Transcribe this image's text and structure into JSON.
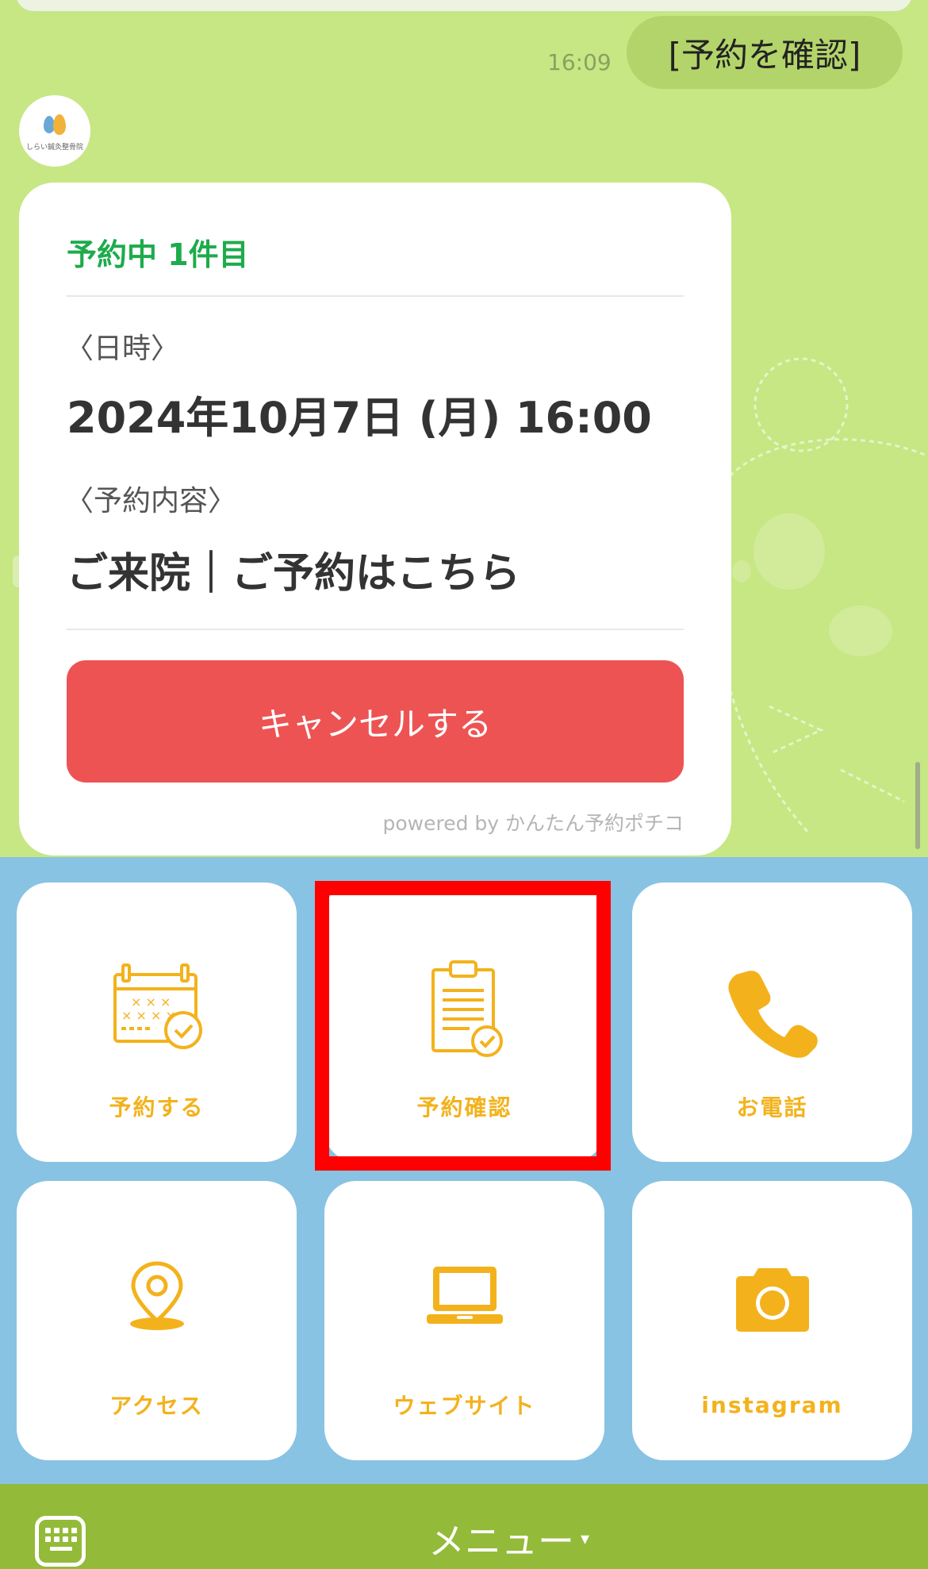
{
  "chat": {
    "sent_message": "[予約を確認]",
    "sent_time": "16:09",
    "avatar_name": "しらい鍼灸整骨院"
  },
  "card": {
    "title": "予約中 1件目",
    "datetime_label": "〈日時〉",
    "datetime_value": "2024年10月7日 (月) 16:00",
    "content_label": "〈予約内容〉",
    "content_value": "ご来院｜ご予約はこちら",
    "cancel_label": "キャンセルする",
    "powered_by": "powered by かんたん予約ポチコ",
    "title_color": "#1eab4c",
    "cancel_color": "#ee5353"
  },
  "menu": {
    "tiles": [
      {
        "label": "予約する",
        "icon": "calendar-check-icon"
      },
      {
        "label": "予約確認",
        "icon": "clipboard-check-icon"
      },
      {
        "label": "お電話",
        "icon": "phone-icon"
      },
      {
        "label": "アクセス",
        "icon": "map-pin-icon"
      },
      {
        "label": "ウェブサイト",
        "icon": "laptop-icon"
      },
      {
        "label": "instagram",
        "icon": "camera-icon"
      }
    ],
    "accent_color": "#f3b21c",
    "background_color": "#88c3e3",
    "highlight_color": "#ff0000"
  },
  "bottom_bar": {
    "menu_label": "メニュー",
    "caret": "▾",
    "keyboard_icon": "keyboard-icon"
  }
}
